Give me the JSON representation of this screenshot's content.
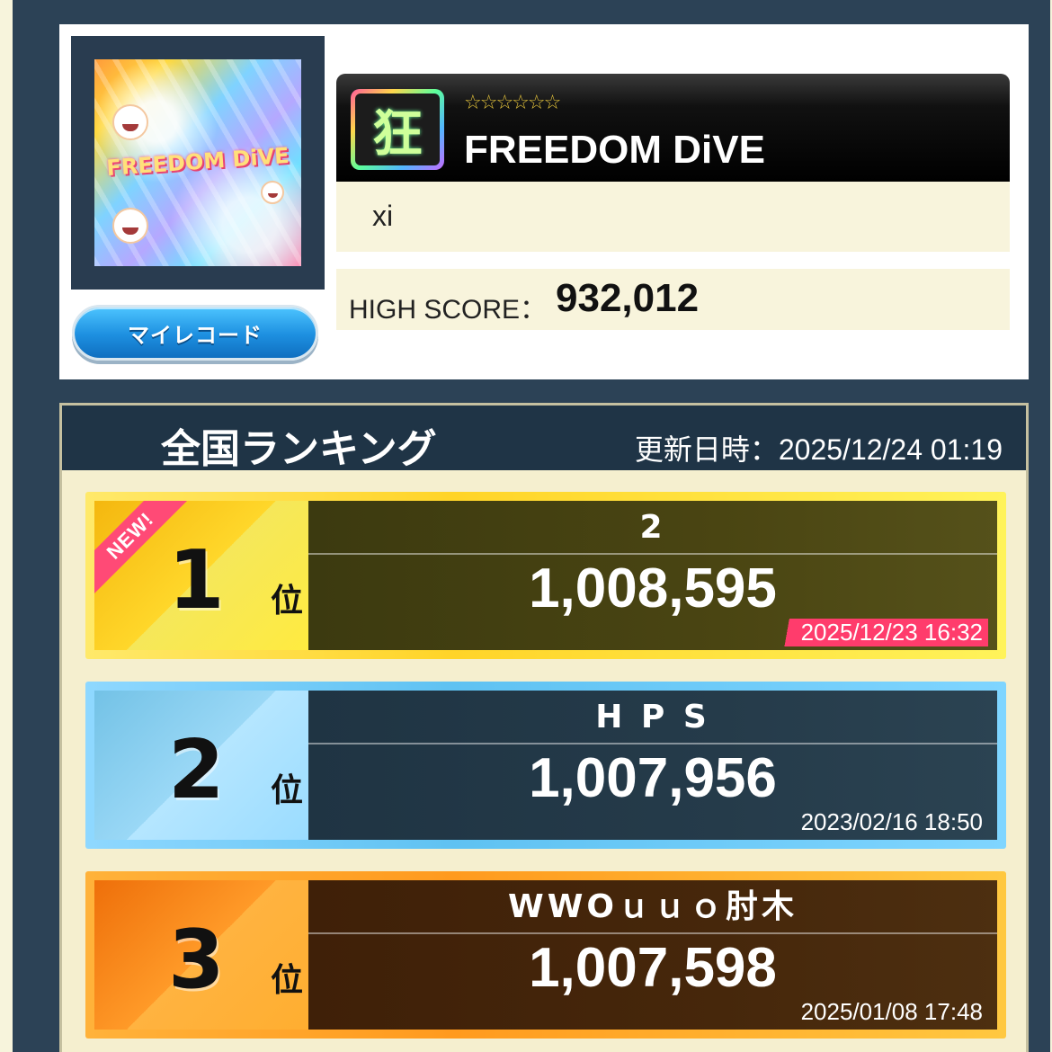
{
  "song": {
    "jacket_text": "FREEDOM DiVE",
    "difficulty_icon": "狂",
    "stars": "☆☆☆☆☆☆",
    "title": "FREEDOM DiVE",
    "artist": "xi",
    "high_score_label": "HIGH SCORE：",
    "high_score": "932,012",
    "my_record_button": "マイレコード"
  },
  "ranking": {
    "title": "全国ランキング",
    "updated": "更新日時：2025/12/24 01:19",
    "suffix": "位",
    "entries": [
      {
        "rank": "1",
        "badge": "NEW!",
        "name": "2",
        "score": "1,008,595",
        "date": "2025/12/23 16:32"
      },
      {
        "rank": "2",
        "name": "H P S",
        "score": "1,007,956",
        "date": "2023/02/16 18:50"
      },
      {
        "rank": "3",
        "name": "WWOｕｕｏ肘木",
        "score": "1,007,598",
        "date": "2025/01/08 17:48"
      }
    ]
  },
  "colors": {
    "background": "#2c4256",
    "rank1": "#ffd428",
    "rank2": "#5fc2f2",
    "rank3": "#ff9a1e",
    "new_badge": "#ff4a76"
  }
}
